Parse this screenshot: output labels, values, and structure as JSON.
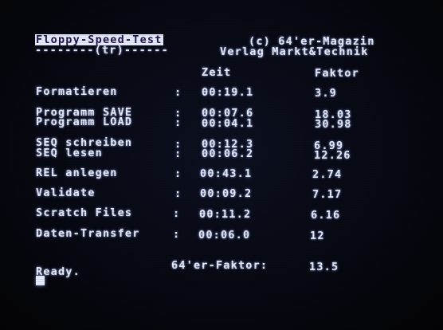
{
  "header": {
    "title": "Floppy-Speed-Test",
    "underline": "--------(tr)------",
    "copyright": "(c) 64'er-Magazin",
    "publisher": "Verlag Markt&Technik"
  },
  "columns": {
    "time": "Zeit",
    "factor": "Faktor"
  },
  "rows": [
    {
      "label": "Formatieren",
      "sep": ":",
      "time": "00:19.1",
      "factor": "3.9"
    },
    {
      "label": "Programm SAVE",
      "sep": ":",
      "time": "00:07.6",
      "factor": "18.03"
    },
    {
      "label": "Programm LOAD",
      "sep": ":",
      "time": "00:04.1",
      "factor": "30.98"
    },
    {
      "label": "SEQ schreiben",
      "sep": ":",
      "time": "00:12.3",
      "factor": "6.99"
    },
    {
      "label": "SEQ lesen",
      "sep": ":",
      "time": "00:06.2",
      "factor": "12.26"
    },
    {
      "label": "REL anlegen",
      "sep": ":",
      "time": "00:43.1",
      "factor": "2.74"
    },
    {
      "label": "Validate",
      "sep": ":",
      "time": "00:09.2",
      "factor": "7.17"
    },
    {
      "label": "Scratch Files",
      "sep": ":",
      "time": "00:11.2",
      "factor": "6.16"
    },
    {
      "label": "Daten-Transfer",
      "sep": ":",
      "time": "00:06.0",
      "factor": "12"
    }
  ],
  "summary": {
    "label": "64'er-Faktor:",
    "value": "13.5"
  },
  "prompt": "Ready.",
  "colors": {
    "background": "#070912",
    "text": "#e6ecff",
    "title_inverse_fg": "#20124a"
  }
}
